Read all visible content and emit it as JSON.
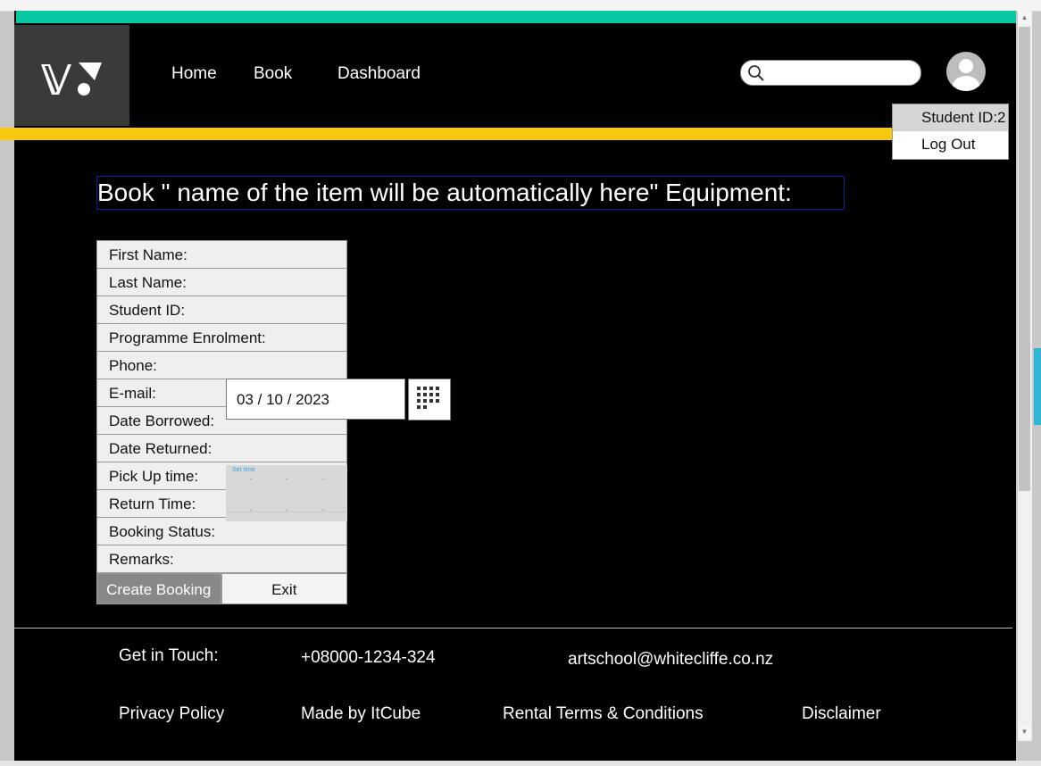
{
  "nav": {
    "home": "Home",
    "book": "Book",
    "dashboard": "Dashboard"
  },
  "search": {
    "placeholder": ""
  },
  "user_menu": {
    "student_id": "Student ID:2",
    "logout": "Log Out"
  },
  "page_title": "Book \" name of the item will be automatically here\" Equipment:",
  "form": {
    "fields": [
      "First Name:",
      "Last Name:",
      "Student ID:",
      "Programme Enrolment:",
      "Phone:",
      "E-mail:",
      "Date Borrowed:",
      "Date Returned:",
      "Pick Up time:",
      "Return Time:",
      "Booking Status:",
      "Remarks:"
    ],
    "create_button": "Create Booking",
    "exit_button": "Exit",
    "date_value": "03 / 10 / 2023"
  },
  "time_picker": {
    "title": "Set time"
  },
  "footer": {
    "get_in_touch": "Get in Touch:",
    "phone": "+08000-1234-324",
    "email": "artschool@whitecliffe.co.nz",
    "privacy": "Privacy Policy",
    "made_by": "Made by ItCube",
    "rental_terms": "Rental Terms & Conditions",
    "disclaimer": "Disclaimer"
  },
  "colors": {
    "top_bar": "#07c7a0",
    "accent_bar": "#f8c80c",
    "background": "#000000"
  },
  "icons": [
    "search-icon",
    "user-avatar-icon",
    "calendar-icon",
    "logo"
  ]
}
